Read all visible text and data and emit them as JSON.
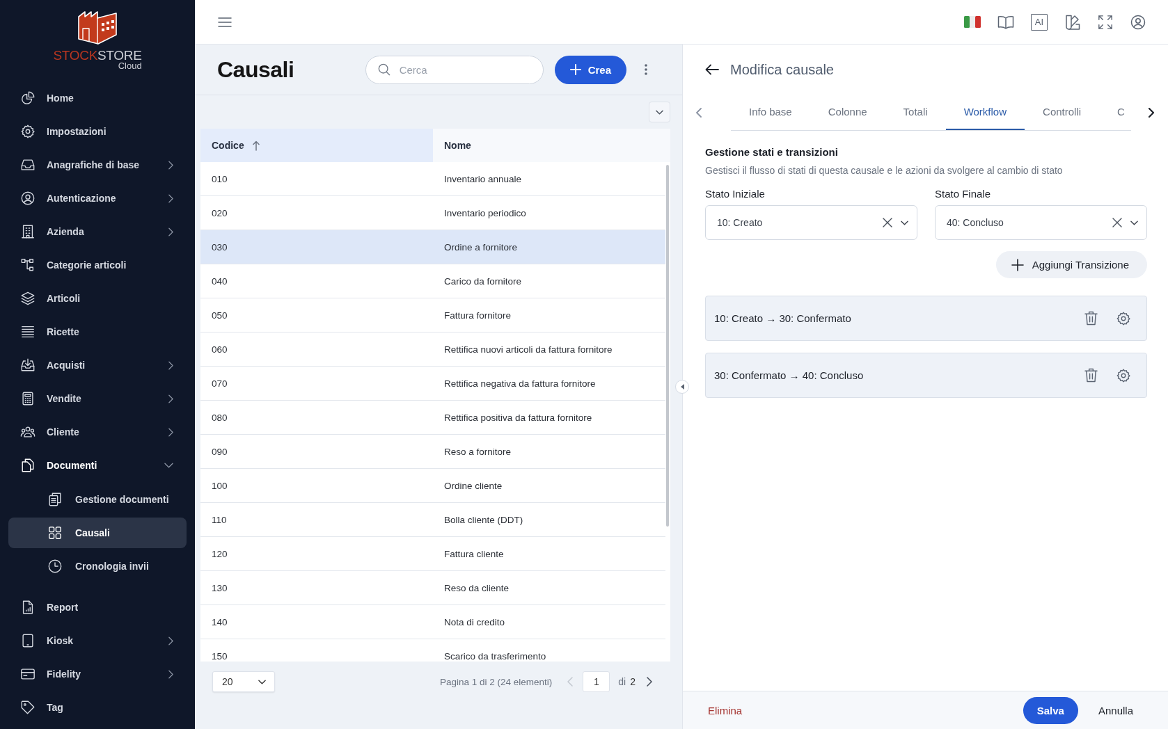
{
  "sidebar": {
    "logo": {
      "wordmark_accent": "STOCK",
      "wordmark_rest": "STORE",
      "subtitle": "Cloud"
    },
    "items": [
      {
        "label": "Home",
        "kind": "link",
        "selected": false
      },
      {
        "label": "Impostazioni",
        "kind": "link",
        "selected": false
      },
      {
        "label": "Anagrafiche di base",
        "kind": "group",
        "expanded": false,
        "selected": false
      },
      {
        "label": "Autenticazione",
        "kind": "group",
        "expanded": false,
        "selected": false
      },
      {
        "label": "Azienda",
        "kind": "group",
        "expanded": false,
        "selected": false
      },
      {
        "label": "Categorie articoli",
        "kind": "link",
        "selected": false
      },
      {
        "label": "Articoli",
        "kind": "link",
        "selected": false
      },
      {
        "label": "Ricette",
        "kind": "link",
        "selected": false
      },
      {
        "label": "Acquisti",
        "kind": "group",
        "expanded": false,
        "selected": false
      },
      {
        "label": "Vendite",
        "kind": "group",
        "expanded": false,
        "selected": false
      },
      {
        "label": "Cliente",
        "kind": "group",
        "expanded": false,
        "selected": false
      },
      {
        "label": "Documenti",
        "kind": "group",
        "expanded": true,
        "selected": false,
        "children": [
          {
            "label": "Gestione documenti",
            "selected": false
          },
          {
            "label": "Causali",
            "selected": true
          },
          {
            "label": "Cronologia invii",
            "selected": false
          }
        ]
      },
      {
        "label": "Report",
        "kind": "link",
        "selected": false
      },
      {
        "label": "Kiosk",
        "kind": "group",
        "expanded": false,
        "selected": false
      },
      {
        "label": "Fidelity",
        "kind": "group",
        "expanded": false,
        "selected": false
      },
      {
        "label": "Tag",
        "kind": "link",
        "selected": false
      }
    ]
  },
  "top_bar": {
    "ai_button": {
      "label": "AI"
    }
  },
  "list_panel": {
    "title": "Causali",
    "search": {
      "placeholder": "Cerca"
    },
    "create_button": {
      "label": "Crea"
    },
    "table": {
      "columns": [
        {
          "label": "Codice",
          "sorted": true
        },
        {
          "label": "Nome",
          "sorted": false
        }
      ],
      "rows": [
        {
          "code": "010",
          "name": "Inventario annuale",
          "selected": false
        },
        {
          "code": "020",
          "name": "Inventario periodico",
          "selected": false
        },
        {
          "code": "030",
          "name": "Ordine a fornitore",
          "selected": true
        },
        {
          "code": "040",
          "name": "Carico da fornitore",
          "selected": false
        },
        {
          "code": "050",
          "name": "Fattura fornitore",
          "selected": false
        },
        {
          "code": "060",
          "name": "Rettifica nuovi articoli da fattura fornitore",
          "selected": false
        },
        {
          "code": "070",
          "name": "Rettifica negativa da fattura fornitore",
          "selected": false
        },
        {
          "code": "080",
          "name": "Rettifica positiva da fattura fornitore",
          "selected": false
        },
        {
          "code": "090",
          "name": "Reso a fornitore",
          "selected": false
        },
        {
          "code": "100",
          "name": "Ordine cliente",
          "selected": false
        },
        {
          "code": "110",
          "name": "Bolla cliente (DDT)",
          "selected": false
        },
        {
          "code": "120",
          "name": "Fattura cliente",
          "selected": false
        },
        {
          "code": "130",
          "name": "Reso da cliente",
          "selected": false
        },
        {
          "code": "140",
          "name": "Nota di credito",
          "selected": false
        },
        {
          "code": "150",
          "name": "Scarico da trasferimento",
          "selected": false
        }
      ]
    },
    "pagination": {
      "page_size": "20",
      "summary": "Pagina 1 di 2 (24 elementi)",
      "prev_disabled": true,
      "page": "1",
      "of_label": "di",
      "total_pages": "2",
      "next_disabled": false
    }
  },
  "detail_panel": {
    "title": "Modifica causale",
    "tabs": [
      {
        "label": "Info base",
        "selected": false
      },
      {
        "label": "Colonne",
        "selected": false
      },
      {
        "label": "Totali",
        "selected": false
      },
      {
        "label": "Workflow",
        "selected": true
      },
      {
        "label": "Controlli",
        "selected": false
      },
      {
        "label": "C",
        "selected": false
      }
    ],
    "section": {
      "title": "Gestione stati e transizioni",
      "description": "Gestisci il flusso di stati di questa causale e le azioni da svolgere al cambio di stato"
    },
    "fields": [
      {
        "label": "Stato Iniziale",
        "value": "10: Creato"
      },
      {
        "label": "Stato Finale",
        "value": "40: Concluso"
      }
    ],
    "add_button": {
      "label": "Aggiungi Transizione"
    },
    "transitions": [
      {
        "label": "10: Creato → 30: Confermato"
      },
      {
        "label": "30: Confermato → 40: Concluso"
      }
    ],
    "footer": {
      "delete_action": {
        "label": "Elimina"
      },
      "save_button": {
        "label": "Salva"
      },
      "cancel_action": {
        "label": "Annulla"
      }
    }
  }
}
